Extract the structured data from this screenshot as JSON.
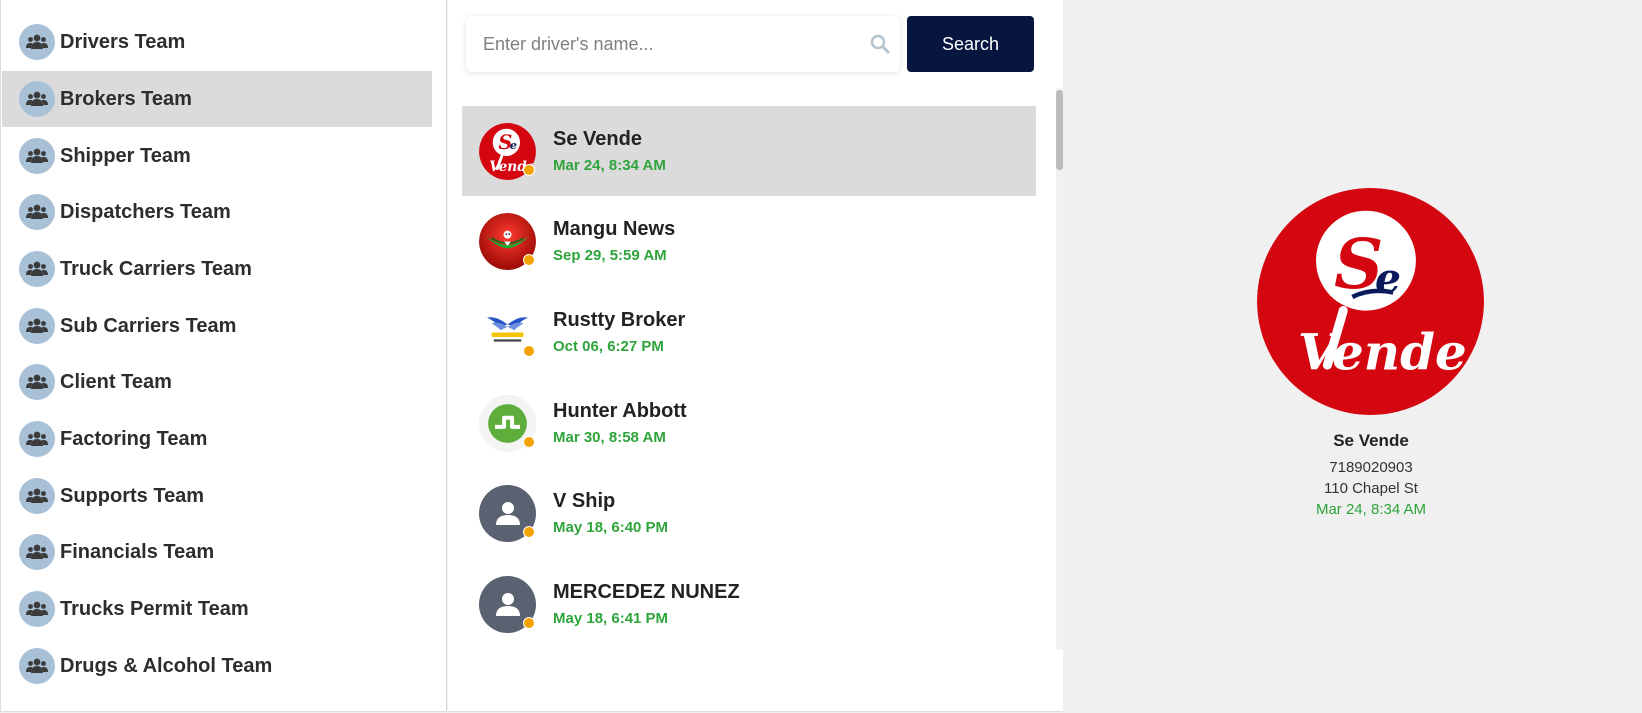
{
  "colors": {
    "accent_navy": "#06163f",
    "online_status": "#f5a300",
    "timestamp_green": "#2ea43b",
    "selected_row": "#dcdbdc",
    "team_icon_bg": "#a9c1d6"
  },
  "sidebar": {
    "teams": [
      {
        "label": "Drivers Team",
        "icon": "users-icon"
      },
      {
        "label": "Brokers Team",
        "icon": "users-icon",
        "active": true
      },
      {
        "label": "Shipper Team",
        "icon": "users-icon"
      },
      {
        "label": "Dispatchers Team",
        "icon": "users-icon"
      },
      {
        "label": "Truck Carriers Team",
        "icon": "users-icon"
      },
      {
        "label": "Sub Carriers Team",
        "icon": "users-icon"
      },
      {
        "label": "Client Team",
        "icon": "users-icon"
      },
      {
        "label": "Factoring Team",
        "icon": "users-icon"
      },
      {
        "label": "Supports Team",
        "icon": "users-icon"
      },
      {
        "label": "Financials Team",
        "icon": "users-icon"
      },
      {
        "label": "Trucks Permit Team",
        "icon": "users-icon"
      },
      {
        "label": "Drugs & Alcohol Team",
        "icon": "users-icon"
      }
    ]
  },
  "search": {
    "placeholder": "Enter driver's name...",
    "value": "",
    "button_label": "Search",
    "icon": "search-icon"
  },
  "contacts": [
    {
      "name": "Se Vende",
      "time": "Mar 24, 8:34 AM",
      "avatar": "se-vende-logo",
      "status": "online",
      "active": true
    },
    {
      "name": "Mangu News",
      "time": "Sep 29, 5:59 AM",
      "avatar": "mangu-news-logo",
      "status": "online"
    },
    {
      "name": "Rustty Broker",
      "time": "Oct 06, 6:27 PM",
      "avatar": "rustty-trucking-logo",
      "status": "online"
    },
    {
      "name": "Hunter Abbott",
      "time": "Mar 30, 8:58 AM",
      "avatar": "green-logo",
      "status": "online"
    },
    {
      "name": "V Ship",
      "time": "May 18, 6:40 PM",
      "avatar": "default-user-icon",
      "status": "online"
    },
    {
      "name": "MERCEDEZ NUNEZ",
      "time": "May 18, 6:41 PM",
      "avatar": "default-user-icon",
      "status": "online"
    }
  ],
  "detail": {
    "avatar": "se-vende-logo",
    "name": "Se Vende",
    "phone": "7189020903",
    "address": "110 Chapel St",
    "time": "Mar 24, 8:34 AM"
  }
}
